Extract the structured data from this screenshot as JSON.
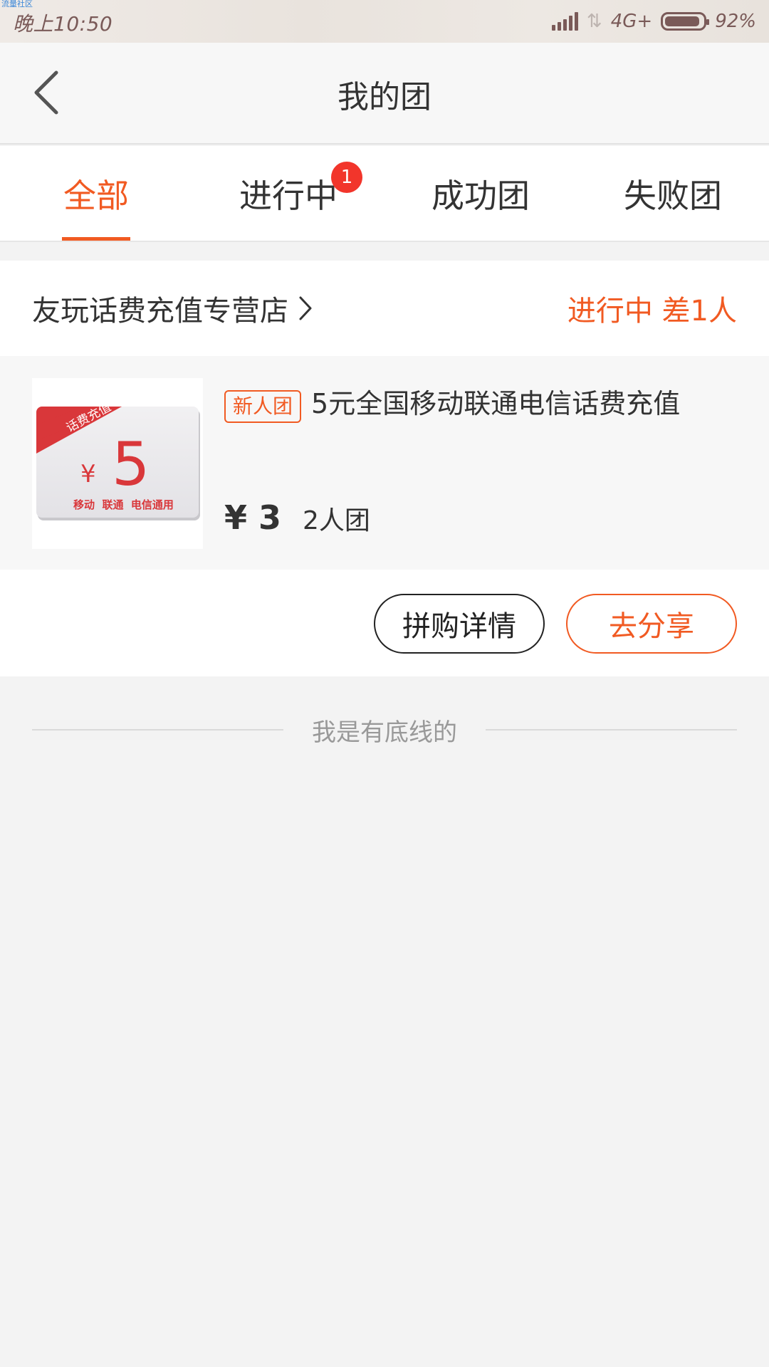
{
  "status_bar": {
    "watermark": "流量社区",
    "time": "晚上10:50",
    "network": "4G+",
    "battery_percent": "92%",
    "battery_level": 0.92,
    "signal_icon": "signal-bars-icon",
    "data_arrows_icon": "data-arrows-icon"
  },
  "nav": {
    "title": "我的团",
    "back_icon": "chevron-left-icon"
  },
  "tabs": {
    "items": [
      {
        "label": "全部",
        "active": true
      },
      {
        "label": "进行中",
        "badge": "1"
      },
      {
        "label": "成功团"
      },
      {
        "label": "失败团"
      }
    ]
  },
  "order": {
    "store_name": "友玩话费充值专营店",
    "store_arrow_icon": "chevron-right-icon",
    "status": "进行中 差1人",
    "product": {
      "tag": "新人团",
      "title": "5元全国移动联通电信话费充值",
      "price": "¥ 3",
      "group_size": "2人团",
      "thumb": {
        "ribbon": "话费充值",
        "currency": "¥",
        "amount": "5",
        "caption": "移动  联通  电信通用"
      }
    },
    "buttons": {
      "detail": "拼购详情",
      "share": "去分享"
    }
  },
  "footer": {
    "text": "我是有底线的"
  },
  "colors": {
    "accent": "#f15a22",
    "badge": "#f2352b",
    "card_red": "#d9373a"
  }
}
